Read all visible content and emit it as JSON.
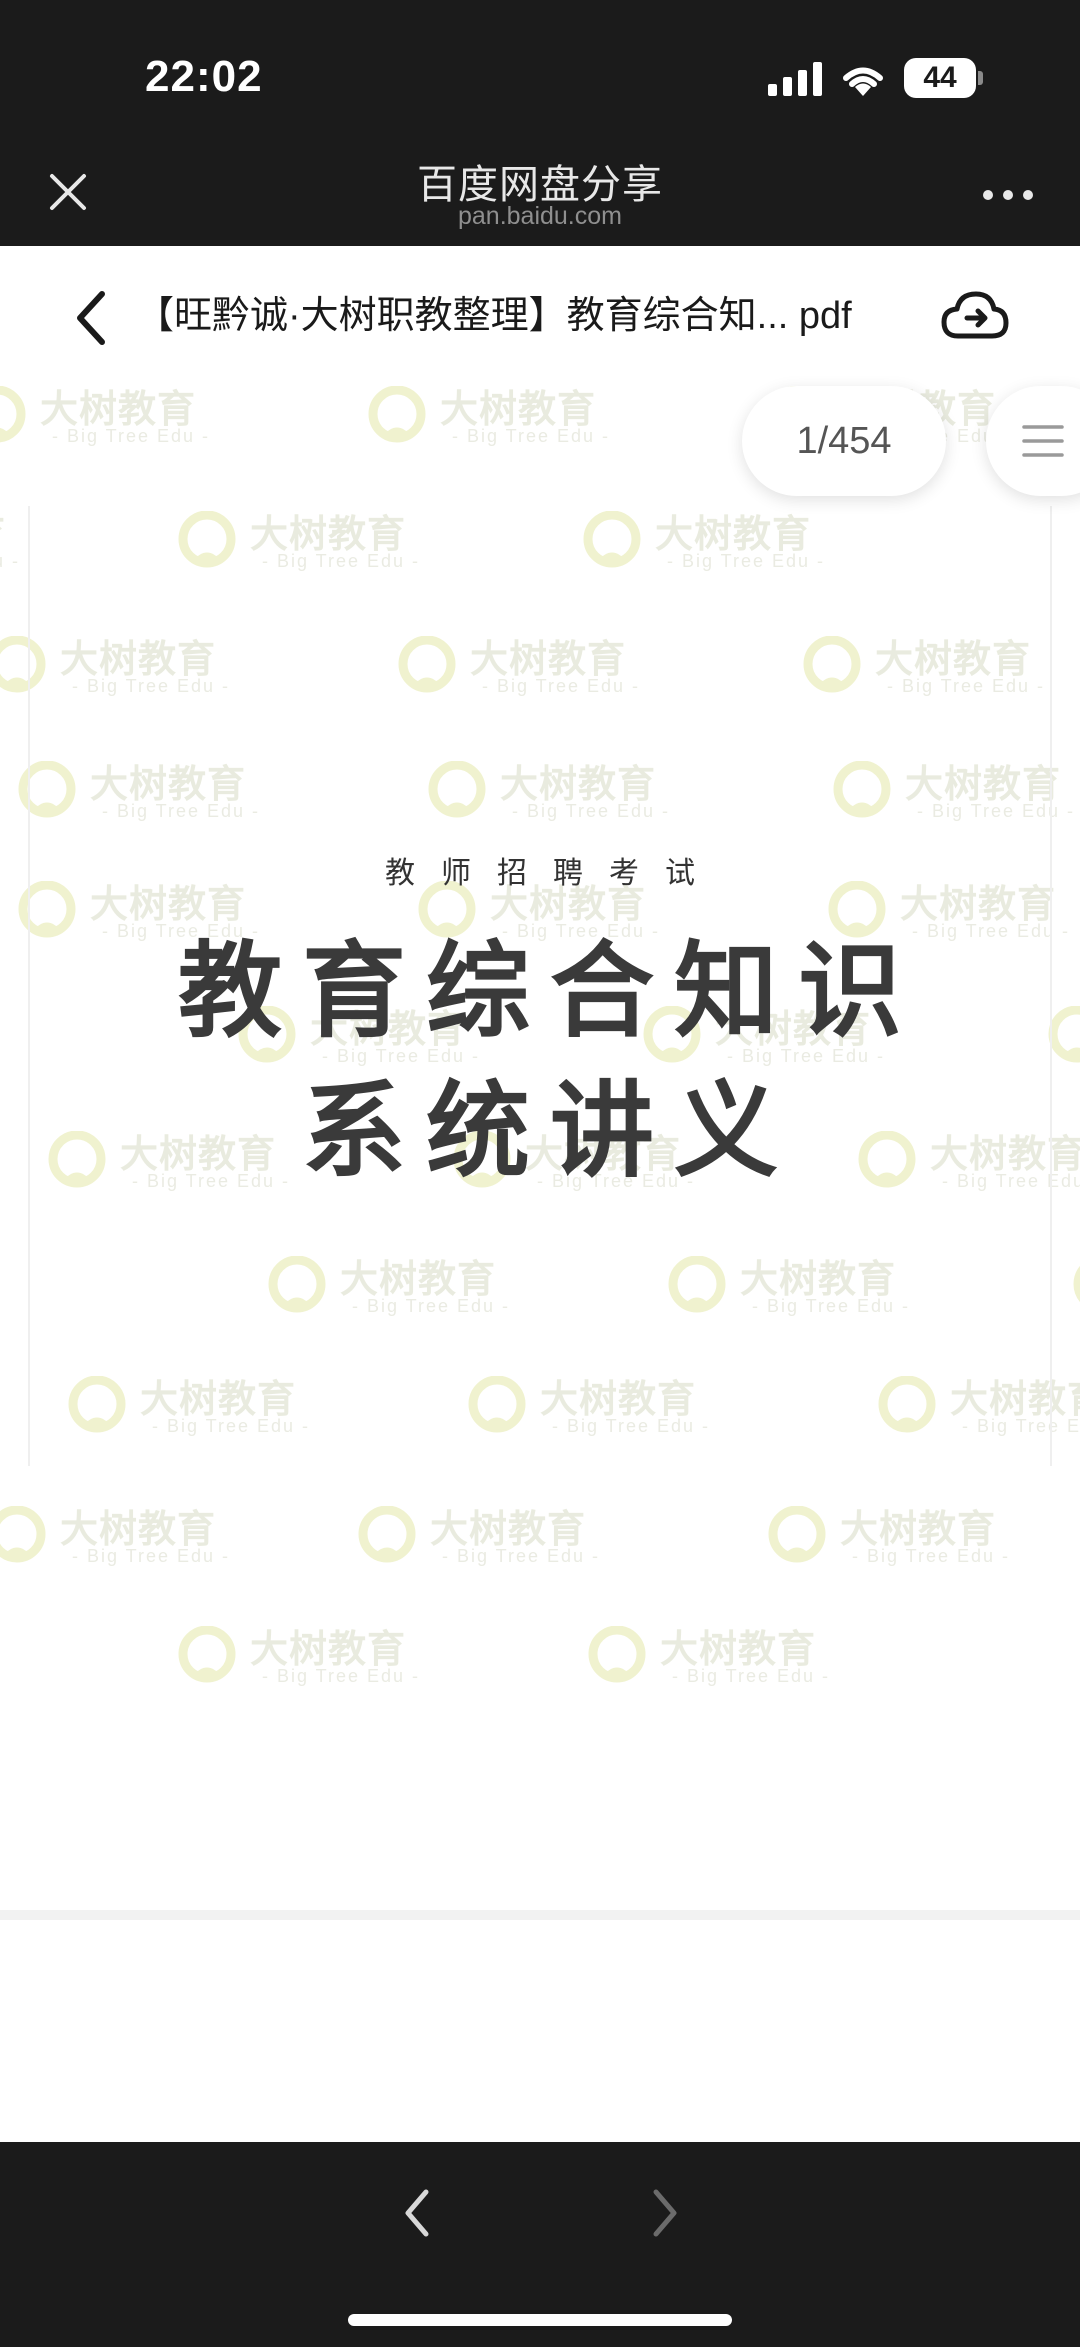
{
  "status_bar": {
    "time": "22:02",
    "battery_level": "44",
    "icons": [
      "signal-icon",
      "wifi-icon",
      "battery-icon"
    ]
  },
  "header": {
    "title": "百度网盘分享",
    "url": "pan.baidu.com",
    "icons": [
      "close-icon",
      "more-icon"
    ]
  },
  "toolbar": {
    "doc_title": "【旺黔诚·大树职教整理】教育综合知... pdf",
    "icons": [
      "back-arrow-icon",
      "cloud-upload-icon"
    ]
  },
  "viewer": {
    "page_indicator": "1/454",
    "menu_icon": "menu-icon"
  },
  "document": {
    "subtitle": "教师招聘考试",
    "heading_line1": "教育综合知识",
    "heading_line2": "系统讲义"
  },
  "watermark": {
    "text_cn": "大树教育",
    "text_en": "- Big Tree Edu -"
  },
  "bottom_bar": {
    "icons": [
      "back-chevron-icon",
      "forward-chevron-icon"
    ]
  },
  "colors": {
    "chrome_background": "#1b1b1b",
    "page_background": "#ffffff",
    "watermark": "#d8dcc6",
    "heading_text": "#3a3a3a"
  }
}
